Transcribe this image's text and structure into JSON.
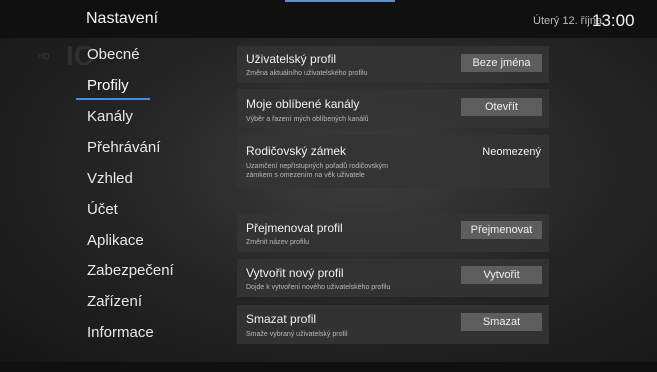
{
  "header": {
    "title": "Nastavení",
    "date": "Úterý 12. října",
    "time": "13:00"
  },
  "background_ghost": {
    "hd": "HD",
    "logo_text": "IC"
  },
  "menu": {
    "items": [
      {
        "label": "Obecné"
      },
      {
        "label": "Profily",
        "active": true
      },
      {
        "label": "Kanály"
      },
      {
        "label": "Přehrávání"
      },
      {
        "label": "Vzhled"
      },
      {
        "label": "Účet"
      },
      {
        "label": "Aplikace"
      },
      {
        "label": "Zabezpečení"
      },
      {
        "label": "Zařízení"
      },
      {
        "label": "Informace"
      }
    ]
  },
  "settings": {
    "user_profile": {
      "title": "Uživatelský profil",
      "subtitle": "Změna aktuálního uživatelského profilu",
      "button": "Beze jména"
    },
    "favorite_channels": {
      "title": "Moje oblíbené kanály",
      "subtitle": "Výběr a řazení mých oblíbených kanálů",
      "button": "Otevřít"
    },
    "parental_lock": {
      "title": "Rodičovský zámek",
      "subtitle_line1": "Uzamčení nepřístupných pořadů rodičovským",
      "subtitle_line2": "zámkem s omezením na věk uživatele",
      "value": "Neomezený"
    },
    "rename_profile": {
      "title": "Přejmenovat profil",
      "subtitle": "Změnit název profilu",
      "button": "Přejmenovat"
    },
    "create_profile": {
      "title": "Vytvořit nový profil",
      "subtitle": "Dojde k vytvoření nového uživatelského profilu",
      "button": "Vytvořit"
    },
    "delete_profile": {
      "title": "Smazat profil",
      "subtitle": "Smaže vybraný uživatelský profil",
      "button": "Smazat"
    }
  },
  "colors": {
    "accent": "#3f8ee8",
    "button_bg": "#5d5d5d",
    "row_bg": "#343434"
  }
}
